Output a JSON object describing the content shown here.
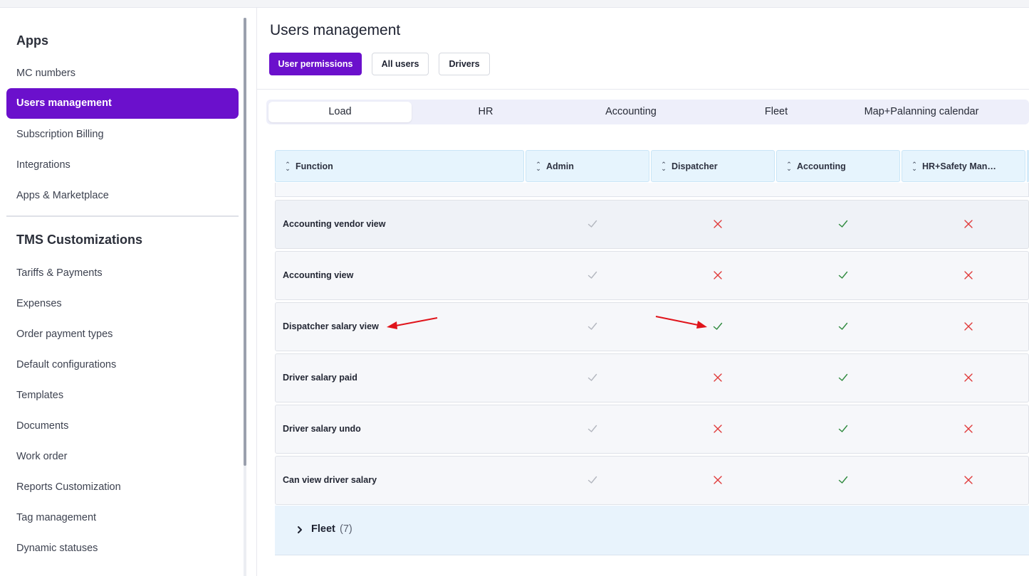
{
  "sidebar": {
    "apps_title": "Apps",
    "apps_items": [
      "MC numbers",
      "Users management",
      "Subscription Billing",
      "Integrations",
      "Apps & Marketplace"
    ],
    "active_item": "Users management",
    "tms_title": "TMS Customizations",
    "tms_items": [
      "Tariffs & Payments",
      "Expenses",
      "Order payment types",
      "Default configurations",
      "Templates",
      "Documents",
      "Work order",
      "Reports Customization",
      "Tag management",
      "Dynamic statuses"
    ]
  },
  "main": {
    "title": "Users management",
    "buttons": [
      "User permissions",
      "All users",
      "Drivers"
    ],
    "active_button": "User permissions",
    "tabs": [
      "Load",
      "HR",
      "Accounting",
      "Fleet",
      "Map+Palanning calendar"
    ],
    "active_tab": "Load"
  },
  "table": {
    "columns": [
      "Function",
      "Admin",
      "Dispatcher",
      "Accounting",
      "HR+Safety Man…"
    ],
    "rows": [
      {
        "label": "Accounting vendor view",
        "perms": [
          "check-muted",
          "cross",
          "check",
          "cross"
        ]
      },
      {
        "label": "Accounting view",
        "perms": [
          "check-muted",
          "cross",
          "check",
          "cross"
        ]
      },
      {
        "label": "Dispatcher salary view",
        "perms": [
          "check-muted",
          "check",
          "check",
          "cross"
        ]
      },
      {
        "label": "Driver salary paid",
        "perms": [
          "check-muted",
          "cross",
          "check",
          "cross"
        ]
      },
      {
        "label": "Driver salary undo",
        "perms": [
          "check-muted",
          "cross",
          "check",
          "cross"
        ]
      },
      {
        "label": "Can view driver salary",
        "perms": [
          "check-muted",
          "cross",
          "check",
          "cross"
        ]
      }
    ],
    "group": {
      "name": "Fleet",
      "count": "(7)"
    }
  },
  "colors": {
    "accent": "#6b10cc",
    "check": "#2f8a3e",
    "check_muted": "#b3b7bf",
    "cross": "#e03a3a",
    "annotation_arrow": "#e0141b"
  },
  "icons": {
    "sort": "sort-updown-icon",
    "check": "check-icon",
    "cross": "cross-icon",
    "chevron": "chevron-right-icon"
  }
}
